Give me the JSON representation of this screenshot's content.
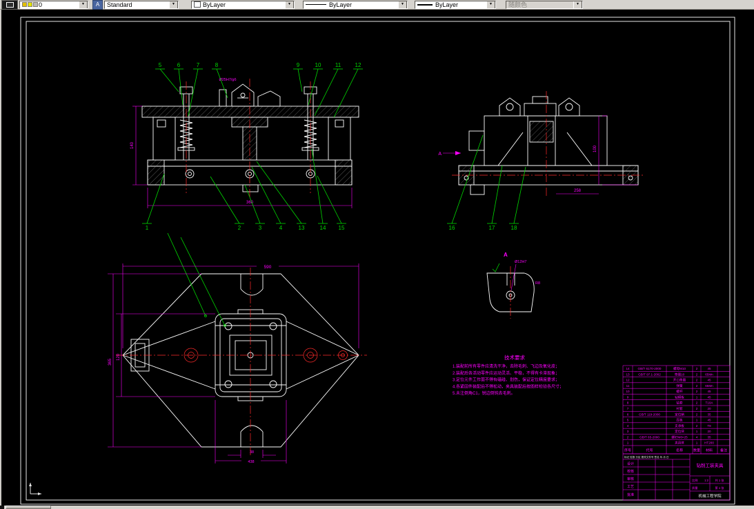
{
  "toolbar": {
    "layer_combo": {
      "value": "0"
    },
    "style_combo": {
      "value": "Standard"
    },
    "color_combo": {
      "value": "ByLayer"
    },
    "linetype_combo": {
      "value": "ByLayer"
    },
    "lineweight_combo": {
      "value": "ByLayer"
    },
    "plotstyle_combo": {
      "value": "随颜色"
    }
  },
  "colors": {
    "geometry": "#ffffff",
    "leader": "#00d800",
    "dimension": "#ff00ff",
    "centerline": "#ff2a2a",
    "chrome": "#d6d3ce"
  },
  "balloons": {
    "front_top": [
      "5",
      "6",
      "7",
      "8",
      "9",
      "10",
      "11",
      "12"
    ],
    "front_bottom": [
      "1",
      "2",
      "3",
      "4",
      "13",
      "14",
      "15"
    ],
    "side_bottom": [
      "16",
      "17",
      "18"
    ]
  },
  "dimensions": {
    "front_height": "140",
    "front_width": "360",
    "front_fit": "Ø25H7/g6",
    "side_height": "100",
    "side_width": "258",
    "datum": "A",
    "plan_width": "590",
    "plan_slot": "38",
    "plan_clamp": "438",
    "plan_height": "365",
    "plan_inner": "120",
    "detail_label": "A",
    "detail_dia": "Ø12H7",
    "detail_radius": "R8"
  },
  "tech_requirements": {
    "title": "技术要求",
    "lines": [
      "1.装配前所有零件应清洗干净，去除毛刺、飞边及氧化皮；",
      "2.装配后各活动零件应运动灵活、平稳，不得有卡滞现象；",
      "3.定位元件工作面不得有磕碰、划伤，保证定位精度要求；",
      "4.各紧固件装配后不得松动，夹具装配后按图样检验各尺寸；",
      "5.未注倒角C1，锐边倒钝去毛刺。"
    ]
  },
  "parts_list": {
    "headers": [
      "序号",
      "代号",
      "名称",
      "数量",
      "材料",
      "备注"
    ],
    "rows": [
      [
        "14",
        "GB/T 6170-2000",
        "螺母M10",
        "2",
        "45",
        ""
      ],
      [
        "13",
        "GB/T 97.1-2002",
        "垫圈10",
        "2",
        "65Mn",
        ""
      ],
      [
        "12",
        "",
        "开口垫圈",
        "2",
        "45",
        ""
      ],
      [
        "11",
        "",
        "弹簧",
        "2",
        "65Mn",
        ""
      ],
      [
        "10",
        "",
        "螺杆",
        "2",
        "45",
        ""
      ],
      [
        "9",
        "",
        "钻模板",
        "1",
        "45",
        ""
      ],
      [
        "8",
        "",
        "钻套",
        "2",
        "T10A",
        ""
      ],
      [
        "7",
        "",
        "衬套",
        "2",
        "20",
        ""
      ],
      [
        "6",
        "GB/T 119-2000",
        "定位销",
        "2",
        "35",
        ""
      ],
      [
        "5",
        "",
        "压板",
        "1",
        "45",
        ""
      ],
      [
        "4",
        "",
        "支承板",
        "2",
        "T8",
        ""
      ],
      [
        "3",
        "",
        "定位块",
        "1",
        "20",
        ""
      ],
      [
        "2",
        "GB/T 65-2000",
        "螺钉M8×25",
        "4",
        "35",
        ""
      ],
      [
        "1",
        "",
        "夹具体",
        "1",
        "HT200",
        ""
      ]
    ]
  },
  "title_block": {
    "revision_row": "标记 处数 分区 更改文件号 签名 年.月.日",
    "rows": [
      "设计",
      "校核",
      "审核",
      "工艺",
      "批准"
    ],
    "title": "钻削工装夹具",
    "scale_label": "比例",
    "scale_value": "1:2",
    "sheets_label": "共 1 张",
    "mass_label": "质量",
    "sheet_label": "第 1 张",
    "company": "机械工程学院"
  }
}
